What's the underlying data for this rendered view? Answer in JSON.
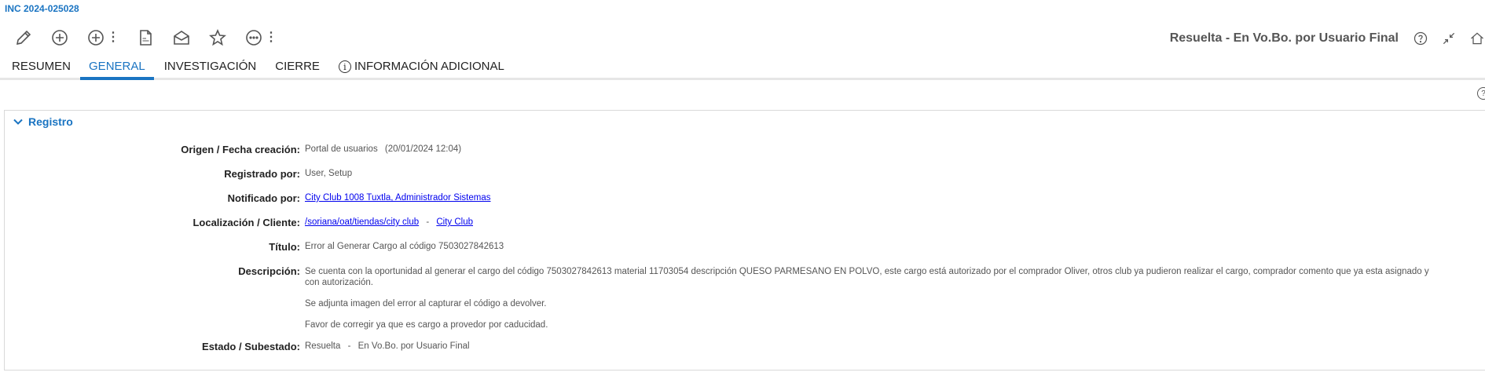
{
  "header": {
    "incident_id": "INC 2024-025028"
  },
  "toolbar": {
    "icons": [
      "pencil-icon",
      "add-circle-icon",
      "add-circle-more-icon",
      "pdf-icon",
      "envelope-icon",
      "star-icon",
      "more-options-icon"
    ]
  },
  "status": {
    "text": "Resuelta - En Vo.Bo. por Usuario Final"
  },
  "tabs": [
    {
      "label": "RESUMEN"
    },
    {
      "label": "GENERAL"
    },
    {
      "label": "INVESTIGACIÓN"
    },
    {
      "label": "CIERRE"
    },
    {
      "label": "INFORMACIÓN ADICIONAL"
    }
  ],
  "panel": {
    "title": "Registro"
  },
  "fields": {
    "origen": {
      "label": "Origen / Fecha creación:",
      "value": "Portal de usuarios",
      "date": "(20/01/2024 12:04)"
    },
    "registrado": {
      "label": "Registrado por:",
      "value": "User, Setup"
    },
    "notificado": {
      "label": "Notificado por:",
      "value": "City Club 1008 Tuxtla, Administrador Sistemas"
    },
    "localizacion": {
      "label": "Localización / Cliente:",
      "value": "/soriana/oat/tiendas/city club",
      "separator": "-",
      "cliente": "City Club"
    },
    "titulo": {
      "label": "Título:",
      "value": "Error al Generar Cargo al código 7503027842613"
    },
    "descripcion": {
      "label": "Descripción:",
      "paragraphs": [
        "Se cuenta con la oportunidad al generar el cargo del código 7503027842613  material 11703054  descripción QUESO PARMESANO EN POLVO, este cargo está autorizado por el comprador Oliver, otros club ya pudieron realizar el cargo, comprador comento que ya esta asignado y con autorización.",
        "Se adjunta imagen del error al capturar el código a devolver.",
        "Favor de corregir ya que es cargo a provedor por caducidad."
      ]
    },
    "estado": {
      "label": "Estado / Subestado:",
      "value": "Resuelta",
      "separator": "-",
      "subestado": "En Vo.Bo. por Usuario Final"
    }
  },
  "colors": {
    "accent": "#1a74c2",
    "link": "#0000ee"
  }
}
